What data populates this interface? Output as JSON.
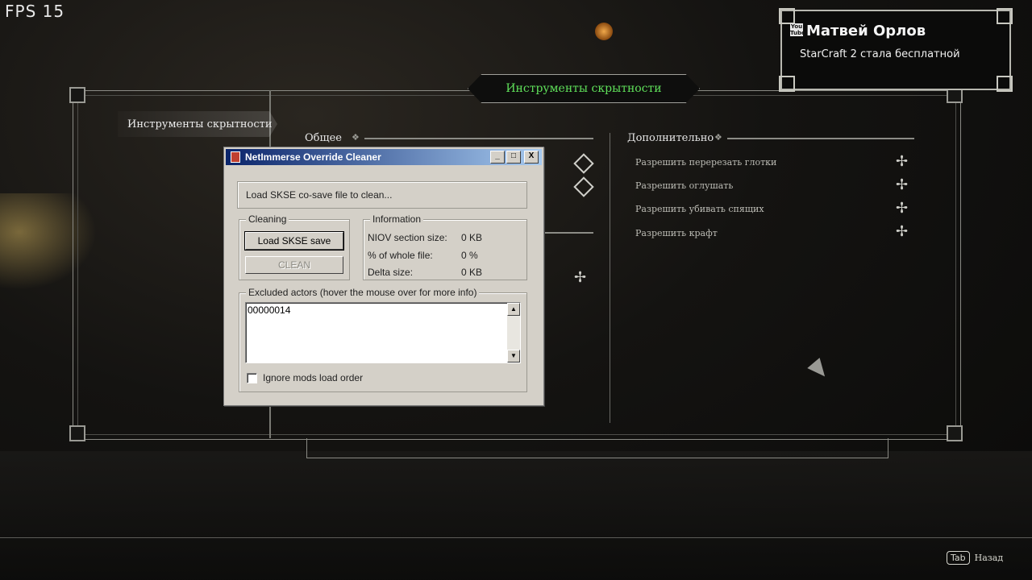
{
  "hud": {
    "fps": "FPS 15"
  },
  "overlay": {
    "channel_name": "Матвей Орлов",
    "message": "StarCraft 2 стала бесплатной",
    "yt_icon_text": "You Tube"
  },
  "mcm": {
    "title": "Инструменты скрытности",
    "selected_mod": "Инструменты скрытности",
    "sections": {
      "general": "Общее",
      "additional": "Дополнительно"
    },
    "additional_options": [
      "Разрешить перерезать глотки",
      "Разрешить оглушать",
      "Разрешить убивать спящих",
      "Разрешить крафт"
    ],
    "footer": {
      "key": "Tab",
      "label": "Назад"
    }
  },
  "dialog": {
    "title": "NetImmerse Override Cleaner",
    "title_buttons": {
      "minimize": "_",
      "maximize": "□",
      "close": "X"
    },
    "load_file_label": "Load SKSE co-save file to clean...",
    "cleaning_group": "Cleaning",
    "load_button": "Load SKSE save",
    "clean_button": "CLEAN",
    "information_group": "Information",
    "info_rows": [
      {
        "label": "NIOV section size:",
        "value": "0 KB"
      },
      {
        "label": "% of whole file:",
        "value": "0 %"
      },
      {
        "label": "Delta size:",
        "value": "0 KB"
      }
    ],
    "excluded_group": "Excluded actors (hover the mouse over for more info)",
    "excluded_text": "00000014",
    "ignore_order_label": "Ignore mods load order",
    "ignore_order_checked": false
  },
  "colors": {
    "title_green": "#5fe05a",
    "win_titlebar_start": "#0a246a",
    "win_titlebar_end": "#a6caf0",
    "win_face": "#d4d0c8"
  }
}
